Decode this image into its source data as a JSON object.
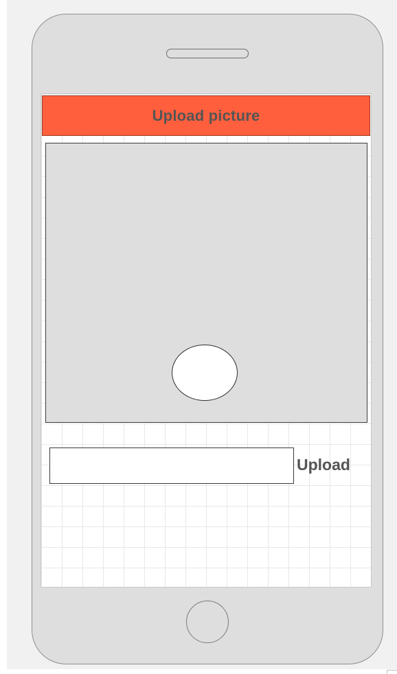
{
  "app": {
    "device": "phone-mockup"
  },
  "header": {
    "title": "Upload picture"
  },
  "image_area": {
    "capture_icon": "circle-capture-icon"
  },
  "upload_form": {
    "input_value": "",
    "input_placeholder": "",
    "button_label": "Upload"
  },
  "colors": {
    "header_bg": "#ff5f3d",
    "header_text": "#555555",
    "device_body": "#dedede",
    "image_area_bg": "#dedede",
    "screen_bg": "#ffffff"
  }
}
